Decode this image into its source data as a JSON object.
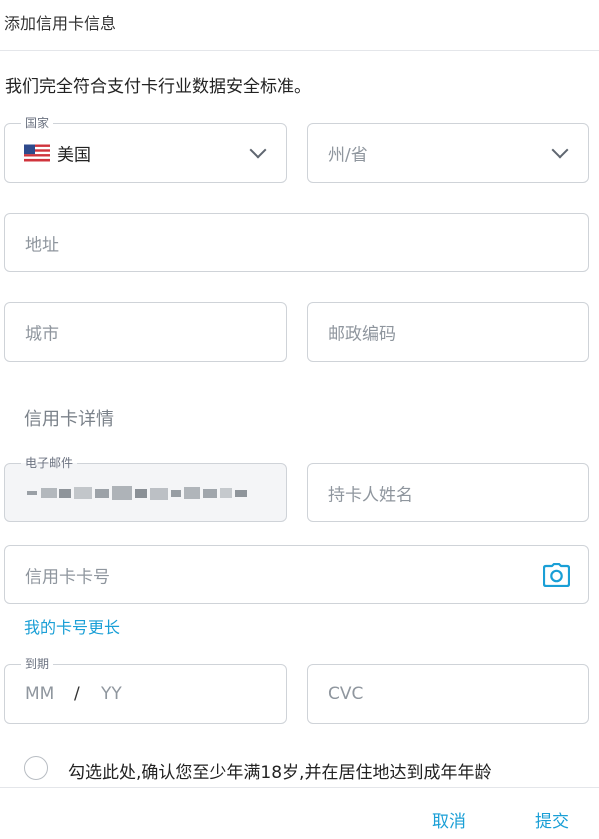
{
  "header": {
    "title": "添加信用卡信息"
  },
  "notice": "我们完全符合支付卡行业数据安全标准。",
  "address": {
    "country": {
      "legend": "国家",
      "value": "美国",
      "flag_icon": "us-flag-icon"
    },
    "state": {
      "placeholder": "州/省"
    },
    "address": {
      "placeholder": "地址"
    },
    "city": {
      "placeholder": "城市"
    },
    "postal": {
      "placeholder": "邮政编码"
    }
  },
  "card": {
    "section_title": "信用卡详情",
    "email": {
      "legend": "电子邮件"
    },
    "holder": {
      "placeholder": "持卡人姓名"
    },
    "number": {
      "placeholder": "信用卡卡号",
      "icon": "camera-icon"
    },
    "longer_link": "我的卡号更长",
    "expiry": {
      "legend": "到期",
      "mm": "MM",
      "slash": "/",
      "yy": "YY"
    },
    "cvc": {
      "placeholder": "CVC"
    }
  },
  "consent": "勾选此处,确认您至少年满18岁,并在居住地达到成年年龄",
  "footer": {
    "cancel": "取消",
    "submit": "提交"
  },
  "colors": {
    "accent": "#1a9fd6",
    "border": "#cfd3d8",
    "placeholder": "#8f969e",
    "disabled_bg": "#f4f5f7"
  }
}
